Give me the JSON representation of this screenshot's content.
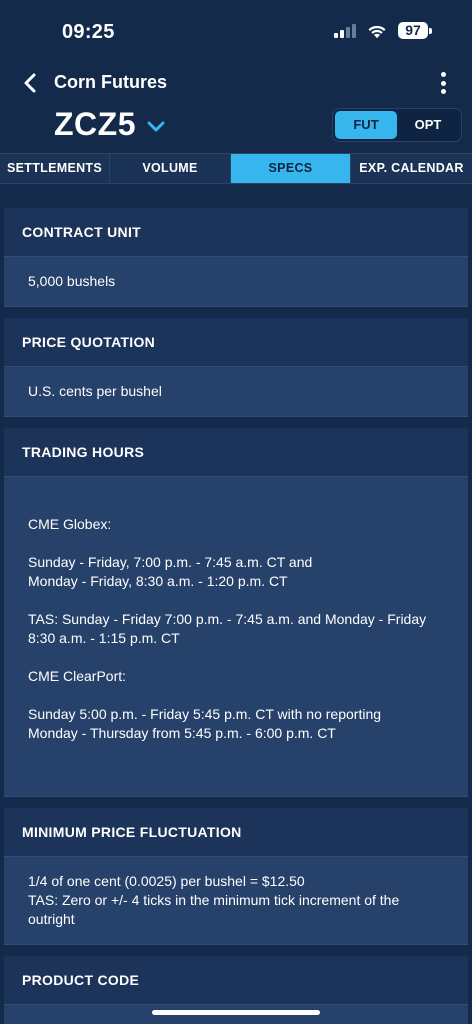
{
  "status": {
    "time": "09:25",
    "battery": "97"
  },
  "header": {
    "title": "Corn Futures",
    "symbol": "ZCZ5",
    "segments": [
      "FUT",
      "OPT"
    ]
  },
  "tabs": [
    "SETTLEMENTS",
    "VOLUME",
    "SPECS",
    "EXP. CALENDAR"
  ],
  "sections": {
    "contract_unit": {
      "title": "CONTRACT UNIT",
      "value": "5,000 bushels"
    },
    "price_quotation": {
      "title": "PRICE QUOTATION",
      "value": "U.S. cents per bushel"
    },
    "trading_hours": {
      "title": "TRADING HOURS",
      "lines": [
        "CME Globex:",
        "Sunday - Friday, 7:00 p.m. - 7:45 a.m. CT and",
        "Monday - Friday, 8:30 a.m. - 1:20 p.m. CT",
        "TAS: Sunday - Friday 7:00 p.m. - 7:45 a.m. and Monday - Friday 8:30 a.m. - 1:15 p.m. CT",
        "CME ClearPort:",
        "Sunday 5:00 p.m. - Friday 5:45 p.m. CT with no reporting",
        "Monday - Thursday from 5:45 p.m. - 6:00 p.m. CT"
      ]
    },
    "min_price_fluctuation": {
      "title": "MINIMUM PRICE FLUCTUATION",
      "lines": [
        "1/4 of one cent (0.0025) per bushel = $12.50",
        "TAS: Zero or +/- 4 ticks in the minimum tick increment of the outright"
      ]
    },
    "product_code": {
      "title": "PRODUCT CODE"
    }
  },
  "colors": {
    "background": "#132a4a",
    "accent": "#36b6ec",
    "card": "#26416a",
    "section_header": "#1c345a"
  }
}
